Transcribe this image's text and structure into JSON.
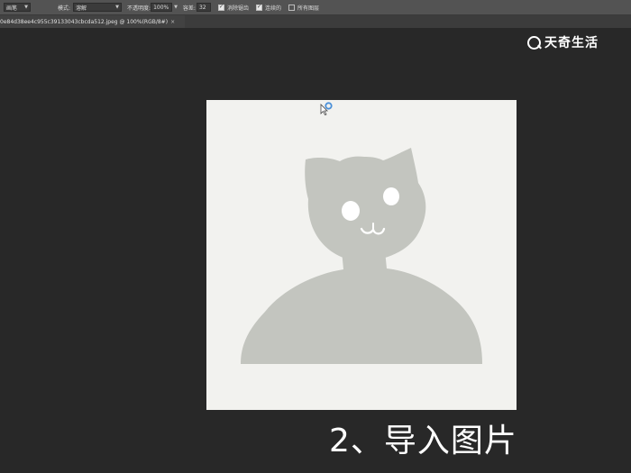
{
  "options_bar": {
    "tool_select": "画笔",
    "mode_label": "模式:",
    "mode_value": "溶解",
    "opacity_label": "不透明度:",
    "opacity_value": "100%",
    "tolerance_label": "容差:",
    "tolerance_value": "32",
    "antialias_label": "消除锯齿",
    "antialias_checked": true,
    "contiguous_label": "连续的",
    "contiguous_checked": true,
    "all_layers_label": "所有图层",
    "all_layers_checked": false
  },
  "tabs": [
    {
      "label": "0e84d38ee4c955c39133043cbcda512.jpeg @ 100%(RGB/8#)",
      "close_icon": "×"
    }
  ],
  "watermark": {
    "text": "天奇生活",
    "icon": "search-icon"
  },
  "caption": "2、导入图片",
  "colors": {
    "workspace": "#282828",
    "canvas": "#f2f2ef",
    "figure": "#c3c5bf",
    "options_bar": "#535353"
  }
}
